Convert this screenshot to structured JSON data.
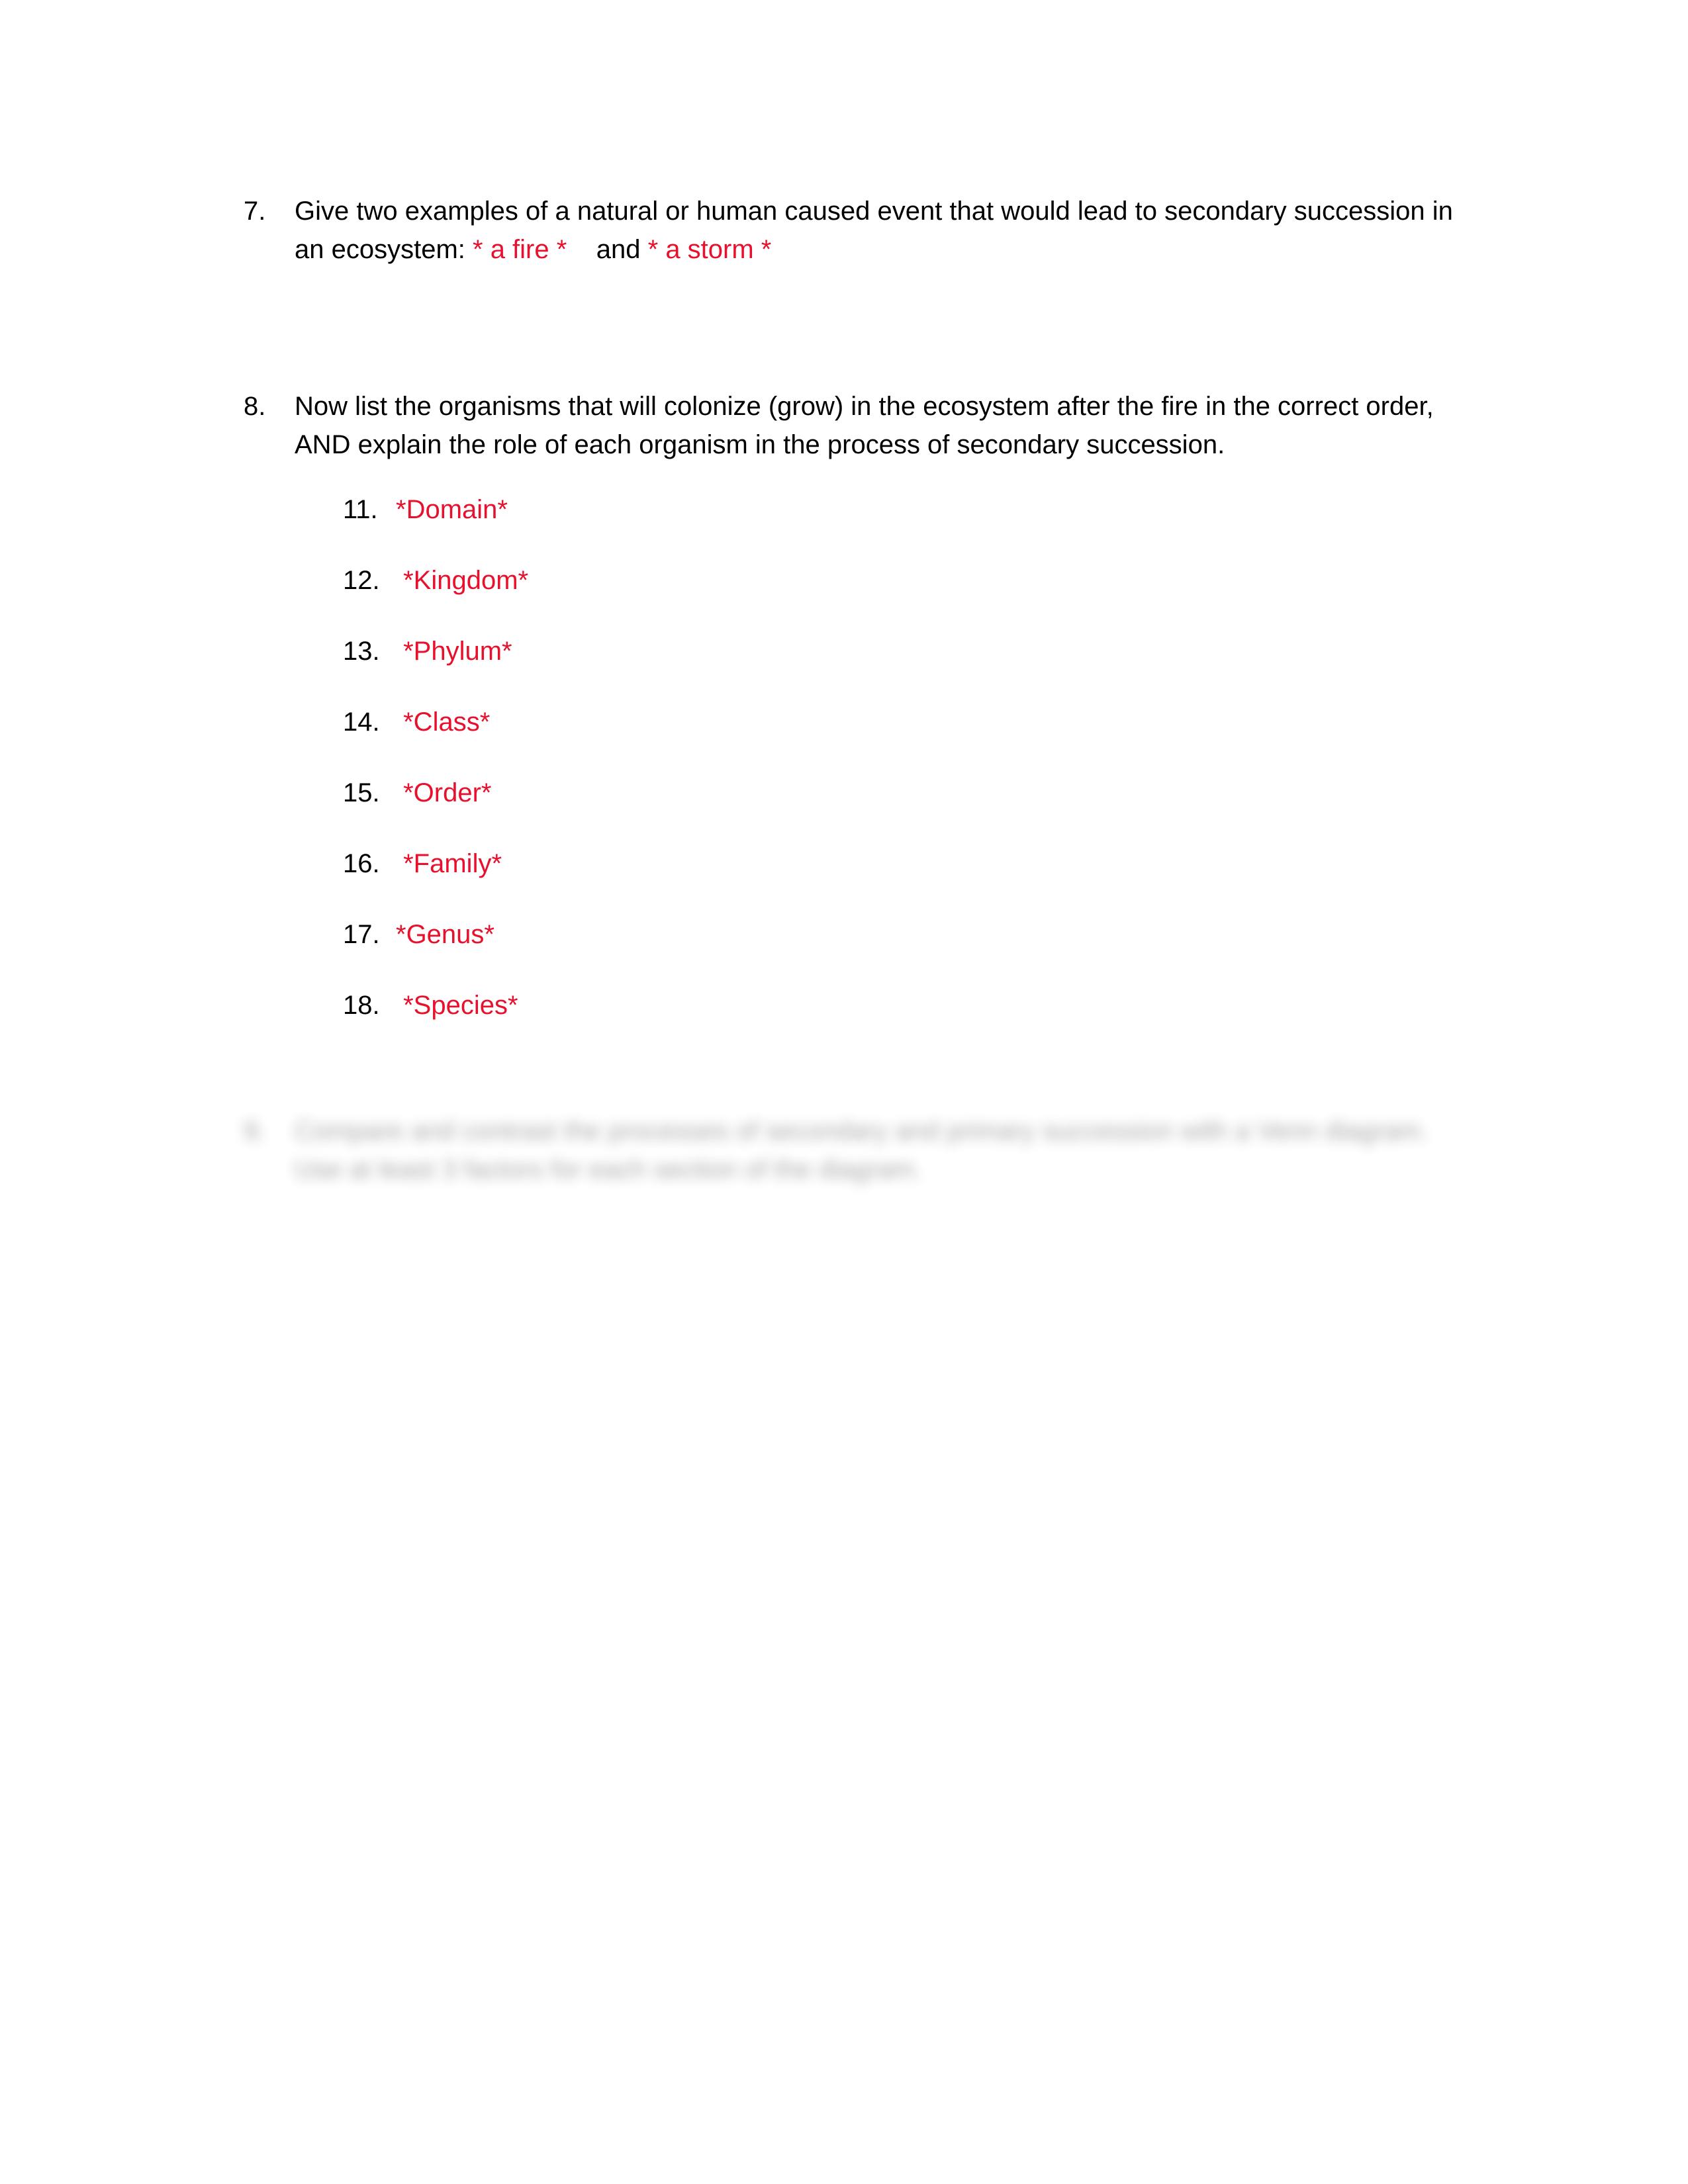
{
  "page": {
    "background_color": "#FFFFFF",
    "text_color": "#000000",
    "answer_color": "#E8112D"
  },
  "questions": [
    {
      "marker": "7.",
      "prompt_part_1": "Give two examples of a natural or human caused event that would lead to secondary succession in an ecosystem: ",
      "answer_1": "* a fire *",
      "conjunction": "and",
      "answer_2": "* a storm *"
    },
    {
      "marker": "8.",
      "prompt": "Now list the organisms that will colonize (grow) in the ecosystem after the fire in the correct order, AND explain the role of each organism in the process of secondary succession."
    },
    {
      "marker": "9.",
      "prompt": "Compare and contrast the processes of secondary and primary succession with a Venn diagram. Use at least 3 factors for each section of the diagram.",
      "redacted": true
    }
  ],
  "taxonomy_list": [
    {
      "number": "11.",
      "label": "*Domain*"
    },
    {
      "number": "12.",
      "label": " *Kingdom*"
    },
    {
      "number": "13.",
      "label": " *Phylum*"
    },
    {
      "number": "14.",
      "label": " *Class*"
    },
    {
      "number": "15.",
      "label": " *Order*"
    },
    {
      "number": "16.",
      "label": " *Family*"
    },
    {
      "number": "17.",
      "label": "*Genus*"
    },
    {
      "number": "18.",
      "label": " *Species*"
    }
  ]
}
